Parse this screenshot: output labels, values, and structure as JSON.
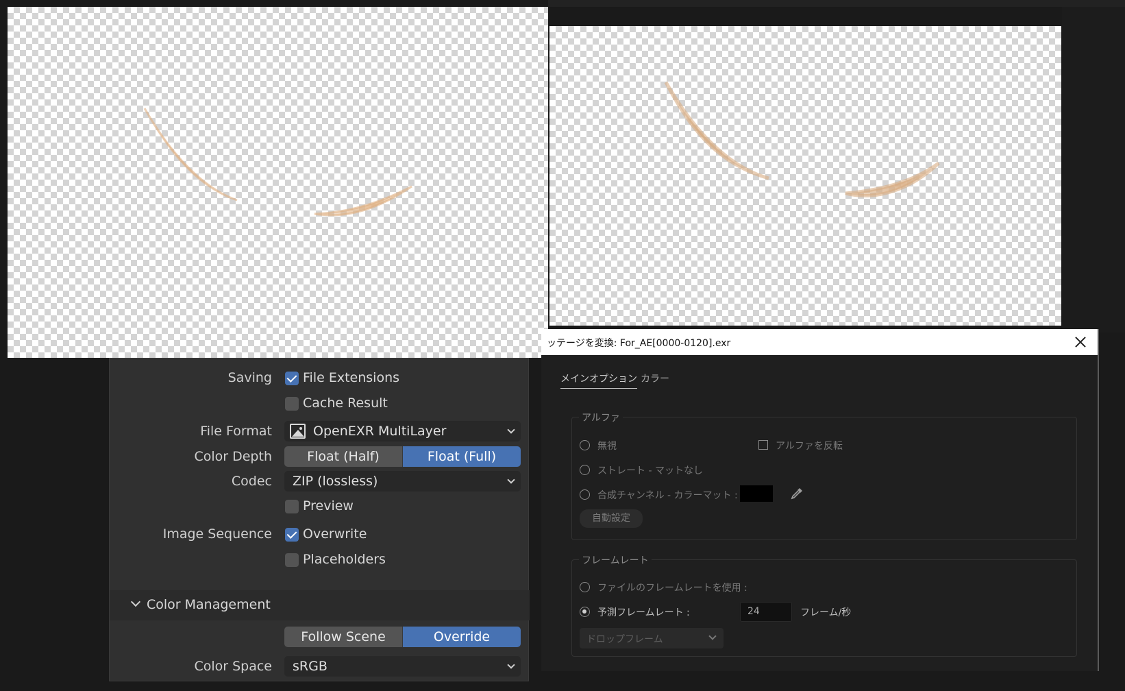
{
  "blender": {
    "saving_label": "Saving",
    "file_extensions": "File Extensions",
    "cache_result": "Cache Result",
    "file_format_label": "File Format",
    "file_format_value": "OpenEXR MultiLayer",
    "color_depth_label": "Color Depth",
    "depth_half": "Float (Half)",
    "depth_full": "Float (Full)",
    "codec_label": "Codec",
    "codec_value": "ZIP (lossless)",
    "preview": "Preview",
    "image_sequence_label": "Image Sequence",
    "overwrite": "Overwrite",
    "placeholders": "Placeholders",
    "color_management": "Color Management",
    "follow_scene": "Follow Scene",
    "override": "Override",
    "color_space_label": "Color Space",
    "color_space_value": "sRGB",
    "accent": "#4772b3"
  },
  "ae": {
    "title": "ッテージを変換: For_AE[0000-0120].exr",
    "tab_main": "メインオプション",
    "tab_color": "カラー",
    "alpha_legend": "アルファ",
    "ignore": "無視",
    "invert_alpha": "アルファを反転",
    "straight": "ストレート - マットなし",
    "premultiplied": "合成チャンネル - カラーマット :",
    "auto_btn": "自動設定",
    "framerate_legend": "フレームレート",
    "use_file_fr": "ファイルのフレームレートを使用 :",
    "assume_fr": "予測フレームレート :",
    "fps_value": "24",
    "fps_unit": "フレーム/秒",
    "drop_frame": "ドロップフレーム"
  },
  "icons": {
    "close": "close-icon",
    "eyedropper": "eyedropper-icon",
    "image": "image-icon",
    "chevron": "chevron-down-icon"
  }
}
